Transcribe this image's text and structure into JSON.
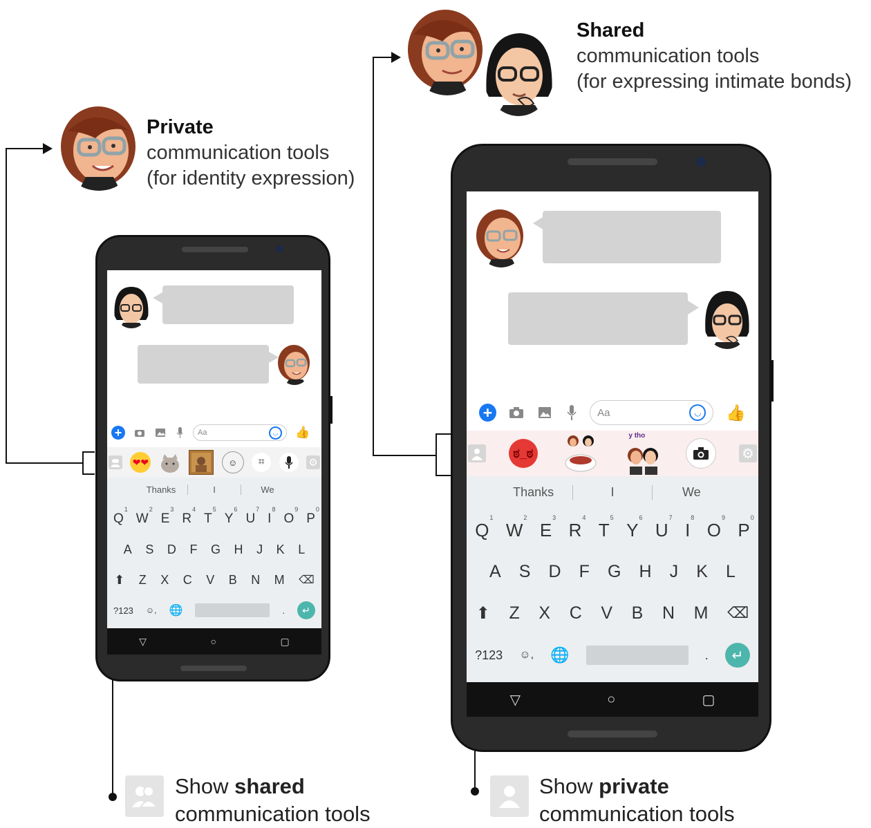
{
  "top_left_caption": {
    "bold": "Private",
    "line2": "communication tools",
    "line3": "(for identity expression)"
  },
  "top_right_caption": {
    "bold": "Shared",
    "line2": "communication tools",
    "line3": "(for expressing intimate bonds)"
  },
  "bottom_left_caption": {
    "prefix": "Show ",
    "bold": "shared",
    "line2": "communication tools"
  },
  "bottom_right_caption": {
    "prefix": "Show ",
    "bold": "private",
    "line2": "communication tools"
  },
  "input_placeholder": "Aa",
  "suggestions": [
    "Thanks",
    "I",
    "We"
  ],
  "keyboard": {
    "row1": [
      "Q",
      "W",
      "E",
      "R",
      "T",
      "Y",
      "U",
      "I",
      "O",
      "P"
    ],
    "row1_numbers": [
      "1",
      "2",
      "3",
      "4",
      "5",
      "6",
      "7",
      "8",
      "9",
      "0"
    ],
    "row2": [
      "A",
      "S",
      "D",
      "F",
      "G",
      "H",
      "J",
      "K",
      "L"
    ],
    "row3": [
      "Z",
      "X",
      "C",
      "V",
      "B",
      "N",
      "M"
    ],
    "symbols_key": "?123",
    "period_key": "."
  },
  "sticker_caption": "y tho",
  "icons": {
    "plus": "plus-circle-icon",
    "camera": "camera-icon",
    "gallery": "image-icon",
    "mic": "microphone-icon",
    "emoji": "smiley-icon",
    "like": "thumbs-up-icon",
    "shared_toggle": "two-people-icon",
    "private_toggle": "person-icon",
    "settings": "gear-icon",
    "shift": "shift-arrow-icon",
    "backspace": "backspace-icon",
    "globe": "globe-icon",
    "enter": "enter-icon",
    "back": "triangle-back-icon",
    "home": "circle-home-icon",
    "recents": "square-recents-icon"
  },
  "colors": {
    "messenger_blue": "#1877f2",
    "enter_green": "#4db6ac",
    "bubble_gray": "#d3d3d3",
    "angry_red": "#e53935"
  }
}
